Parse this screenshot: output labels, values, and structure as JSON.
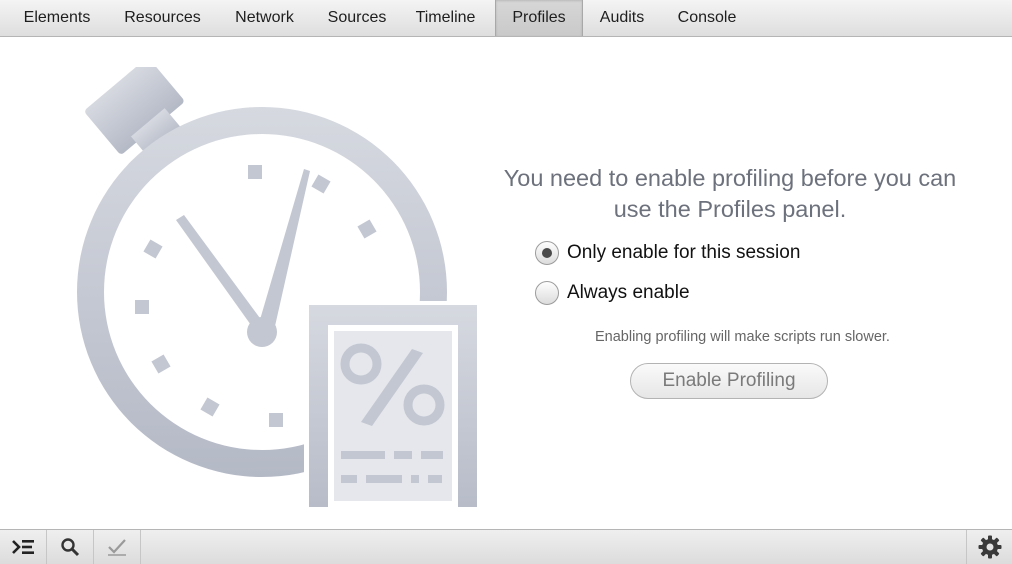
{
  "tabs": [
    {
      "label": "Elements"
    },
    {
      "label": "Resources"
    },
    {
      "label": "Network"
    },
    {
      "label": "Sources"
    },
    {
      "label": "Timeline"
    },
    {
      "label": "Profiles",
      "selected": true
    },
    {
      "label": "Audits"
    },
    {
      "label": "Console"
    }
  ],
  "profiles_panel": {
    "headline": "You need to enable profiling before you can use the Profiles panel.",
    "options": [
      {
        "label": "Only enable for this session",
        "checked": true
      },
      {
        "label": "Always enable",
        "checked": false
      }
    ],
    "note": "Enabling profiling will make scripts run slower.",
    "enable_button": "Enable Profiling"
  },
  "statusbar": {
    "icons": [
      "console-drawer-icon",
      "search-icon",
      "checkmark-icon",
      "gear-icon"
    ]
  },
  "colors": {
    "illustration": "#c9ccd5",
    "headline": "#6c717c",
    "selected_tab": "#cfcfcf"
  }
}
